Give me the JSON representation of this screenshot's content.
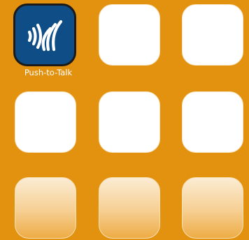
{
  "grid": {
    "apps": [
      {
        "label": "Push-to-Talk",
        "icon": "push-to-talk-icon"
      }
    ]
  },
  "colors": {
    "background": "#e39210",
    "app_icon_background": "#0e4d85",
    "tile_background": "#ffffff",
    "icon_glyph": "#ffffff"
  }
}
